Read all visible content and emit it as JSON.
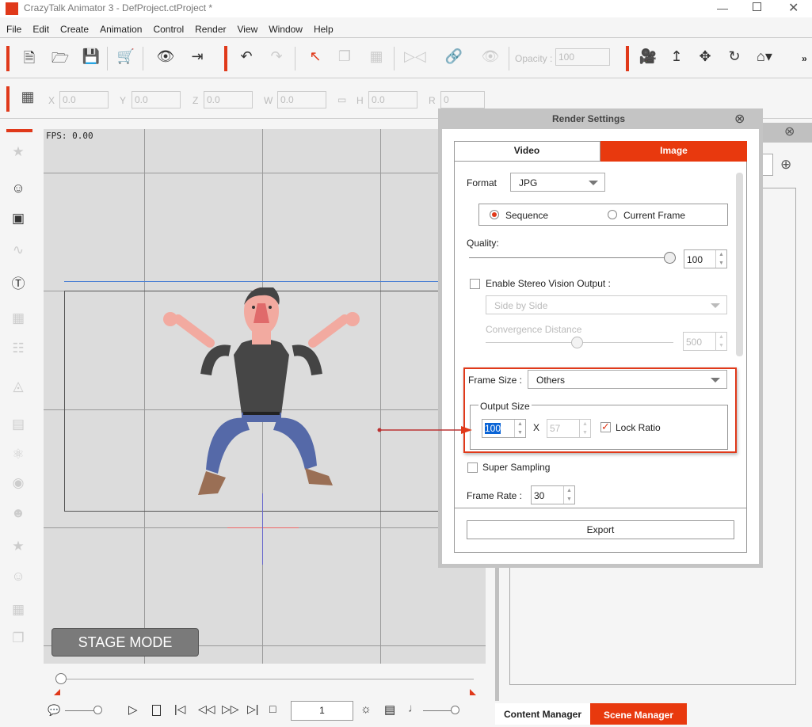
{
  "window": {
    "title": "CrazyTalk Animator 3   - DefProject.ctProject *",
    "controls": [
      "minimize",
      "maximize",
      "close"
    ]
  },
  "menu": [
    "File",
    "Edit",
    "Create",
    "Animation",
    "Control",
    "Render",
    "View",
    "Window",
    "Help"
  ],
  "toolbar": {
    "opacity_label": "Opacity :",
    "opacity_value": "100",
    "more": "»"
  },
  "transform": {
    "x_label": "X",
    "x": "0.0",
    "y_label": "Y",
    "y": "0.0",
    "z_label": "Z",
    "z": "0.0",
    "w_label": "W",
    "w": "0.0",
    "h_label": "H",
    "h": "0.0",
    "r_label": "R",
    "r": "0"
  },
  "stage": {
    "fps": "FPS: 0.00",
    "mode_label": "STAGE MODE"
  },
  "timeline": {
    "frame": "1",
    "position": 0
  },
  "render_settings": {
    "title": "Render Settings",
    "tabs": [
      {
        "label": "Video",
        "active": false
      },
      {
        "label": "Image",
        "active": true
      }
    ],
    "format_label": "Format",
    "format_value": "JPG",
    "sequence_label": "Sequence",
    "current_frame_label": "Current Frame",
    "selected": "Sequence",
    "quality_label": "Quality:",
    "quality_value": "100",
    "quality_percent": 100,
    "stereo_label": "Enable Stereo Vision Output :",
    "stereo_checked": false,
    "stereo_mode": "Side by Side",
    "convergence_label": "Convergence Distance",
    "convergence_value": "500",
    "frame_size_label": "Frame Size :",
    "frame_size_value": "Others",
    "output_size_label": "Output Size",
    "width": "100",
    "x_sep": "X",
    "height": "57",
    "lock_ratio_label": "Lock Ratio",
    "lock_ratio_checked": true,
    "super_sampling_label": "Super Sampling",
    "super_sampling_checked": false,
    "frame_rate_label": "Frame Rate :",
    "frame_rate_value": "30",
    "export_label": "Export"
  },
  "bottom_tabs": [
    {
      "label": "Content Manager",
      "active": false
    },
    {
      "label": "Scene Manager",
      "active": true
    }
  ],
  "colors": {
    "accent": "#e8390e",
    "highlight_box": "#e0391a",
    "stage_bg": "#dcdcdc"
  }
}
